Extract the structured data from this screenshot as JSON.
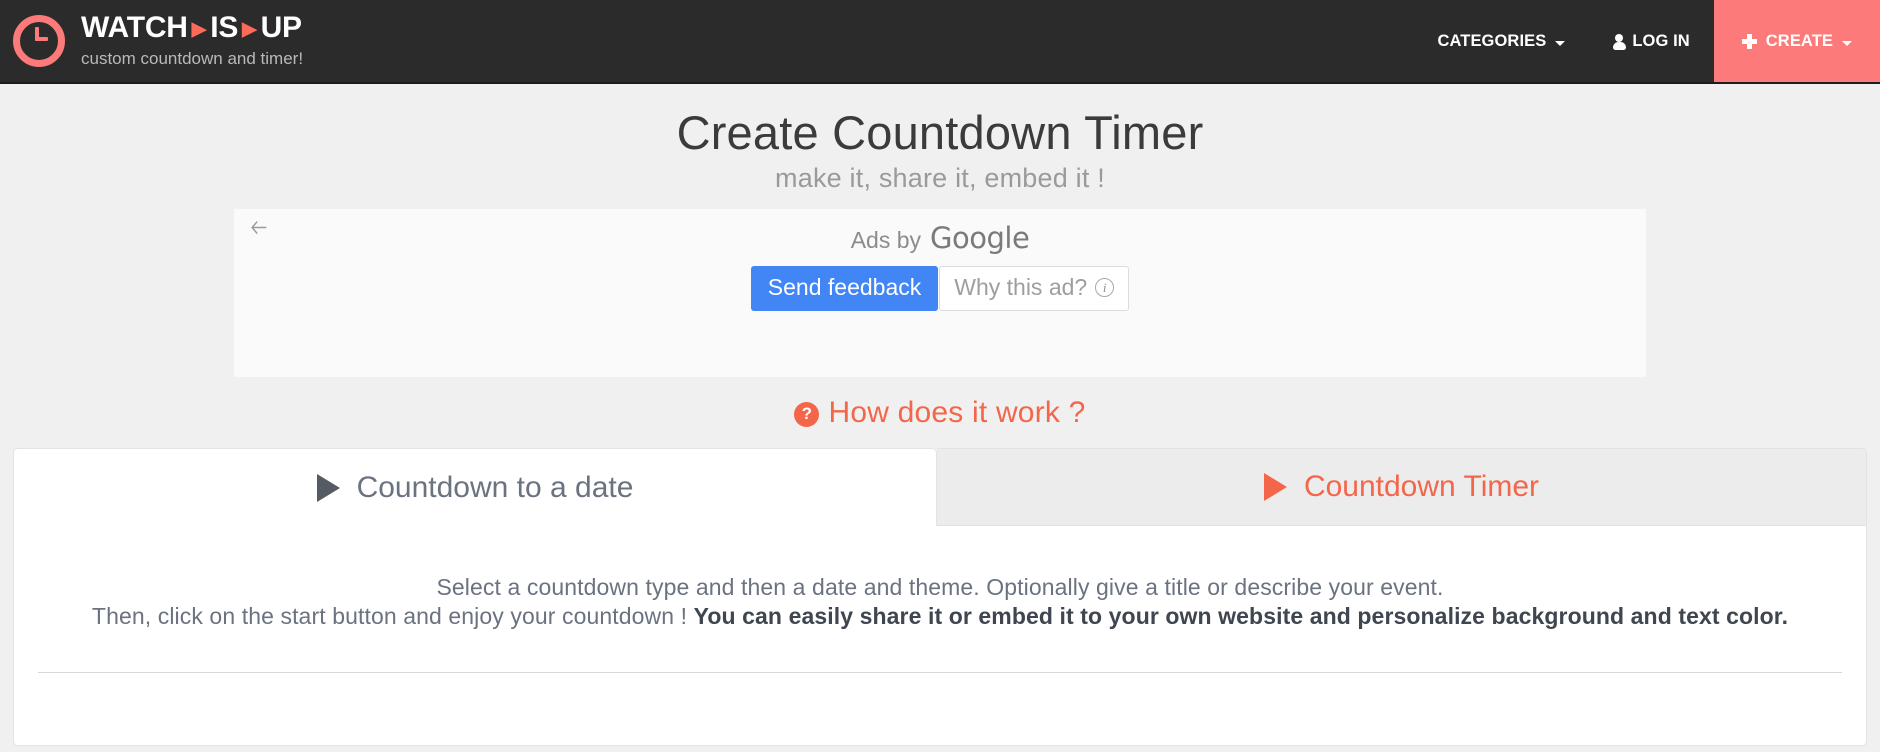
{
  "header": {
    "logo_icon": "clock-icon",
    "brand": {
      "word1": "WATCH",
      "sep1": "▶",
      "word2": "IS",
      "sep2": "▶",
      "word3": "UP",
      "tagline": "custom countdown and timer!"
    },
    "nav": {
      "categories_label": "CATEGORIES",
      "login_label": "LOG IN",
      "create_label": "CREATE"
    },
    "colors": {
      "bar_background": "#2b2b2b",
      "accent": "#fc7a7a",
      "brand_separator": "#fc6a5a"
    }
  },
  "page": {
    "title": "Create Countdown Timer",
    "subtitle": "make it, share it, embed it !"
  },
  "ad": {
    "back_icon": "back-arrow-icon",
    "ads_by_label": "Ads by",
    "google_label": "Google",
    "send_feedback_label": "Send feedback",
    "why_this_ad_label": "Why this ad?",
    "info_glyph": "i",
    "button_color": "#4285f4"
  },
  "howto": {
    "badge_glyph": "?",
    "label": "How does it work ?",
    "color": "#f4664a"
  },
  "tabs": [
    {
      "label": "Countdown to a date",
      "icon": "play-triangle-icon",
      "active": true
    },
    {
      "label": "Countdown Timer",
      "icon": "play-triangle-icon",
      "active": false
    }
  ],
  "panel": {
    "line1": "Select a countdown type and then a date and theme. Optionally give a title or describe your event.",
    "line2_normal": "Then, click on the start button and enjoy your countdown ! ",
    "line2_bold": "You can easily share it or embed it to your own website and personalize background and text color."
  }
}
